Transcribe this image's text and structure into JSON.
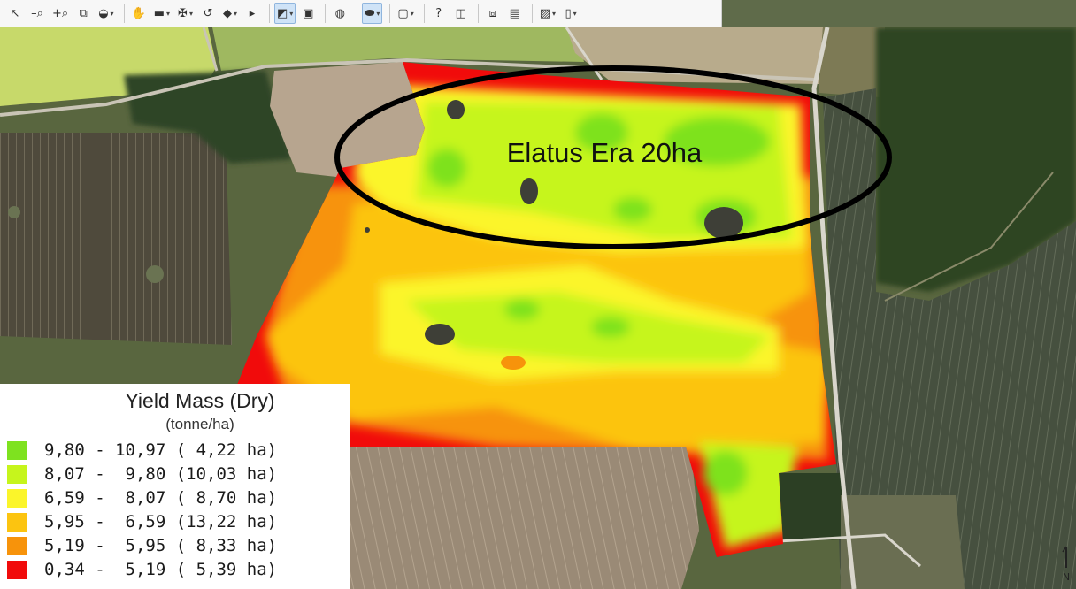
{
  "toolbar": {
    "tools": [
      {
        "name": "select-tool-icon",
        "glyph": "↖",
        "arrow": false,
        "active": false
      },
      {
        "name": "zoom-out-icon",
        "glyph": "–⌕",
        "arrow": false,
        "active": false
      },
      {
        "name": "zoom-in-icon",
        "glyph": "+⌕",
        "arrow": false,
        "active": false
      },
      {
        "name": "zoom-extent-icon",
        "glyph": "⧉",
        "arrow": false,
        "active": false
      },
      {
        "name": "globe-zoom-icon",
        "glyph": "◒",
        "arrow": true,
        "active": false
      },
      {
        "sep": true
      },
      {
        "name": "pan-hand-icon",
        "glyph": "✋",
        "arrow": false,
        "active": false
      },
      {
        "name": "measure-ruler-icon",
        "glyph": "▬",
        "arrow": true,
        "active": false
      },
      {
        "name": "abc-label-icon",
        "glyph": "✠",
        "arrow": true,
        "active": false
      },
      {
        "name": "undo-icon",
        "glyph": "↺",
        "arrow": false,
        "active": false
      },
      {
        "name": "eraser-icon",
        "glyph": "◆",
        "arrow": true,
        "active": false
      },
      {
        "name": "vertex-edit-icon",
        "glyph": "▸",
        "arrow": false,
        "active": false
      },
      {
        "sep": true
      },
      {
        "name": "layer-style-icon",
        "glyph": "◩",
        "arrow": true,
        "active": true
      },
      {
        "name": "layer-add-icon",
        "glyph": "▣",
        "arrow": false,
        "active": false
      },
      {
        "sep": true
      },
      {
        "name": "globe-icon",
        "glyph": "◍",
        "arrow": false,
        "active": false
      },
      {
        "sep": true
      },
      {
        "name": "ellipse-draw-icon",
        "glyph": "⬬",
        "arrow": true,
        "active": true
      },
      {
        "sep": true
      },
      {
        "name": "select-area-icon",
        "glyph": "▢",
        "arrow": true,
        "active": false
      },
      {
        "sep": true
      },
      {
        "name": "help-icon",
        "glyph": "?",
        "arrow": false,
        "active": false
      },
      {
        "name": "identify-icon",
        "glyph": "◫",
        "arrow": false,
        "active": false
      },
      {
        "sep": true
      },
      {
        "name": "copy-layer-icon",
        "glyph": "⧈",
        "arrow": false,
        "active": false
      },
      {
        "name": "report-icon",
        "glyph": "▤",
        "arrow": false,
        "active": false
      },
      {
        "sep": true
      },
      {
        "name": "note-icon",
        "glyph": "▨",
        "arrow": true,
        "active": false
      },
      {
        "name": "new-document-icon",
        "glyph": "▯",
        "arrow": true,
        "active": false
      }
    ]
  },
  "map": {
    "annotation": "Elatus Era 20ha",
    "colors": {
      "class1": "#7ee21f",
      "class2": "#c6f51c",
      "class3": "#fbf52a",
      "class4": "#fcc410",
      "class5": "#f7930b",
      "class6": "#f10b0b"
    }
  },
  "legend": {
    "title": "Yield Mass (Dry)",
    "unit": "(tonne/ha)",
    "items": [
      {
        "label": "9,80 - 10,97 ( 4,22 ha)",
        "color": "#7ee21f"
      },
      {
        "label": "8,07 -  9,80 (10,03 ha)",
        "color": "#c6f51c"
      },
      {
        "label": "6,59 -  8,07 ( 8,70 ha)",
        "color": "#fbf52a"
      },
      {
        "label": "5,95 -  6,59 (13,22 ha)",
        "color": "#fcc410"
      },
      {
        "label": "5,19 -  5,95 ( 8,33 ha)",
        "color": "#f7930b"
      },
      {
        "label": "0,34 -  5,19 ( 5,39 ha)",
        "color": "#f10b0b"
      }
    ]
  },
  "north_arrow": {
    "label": "N"
  }
}
